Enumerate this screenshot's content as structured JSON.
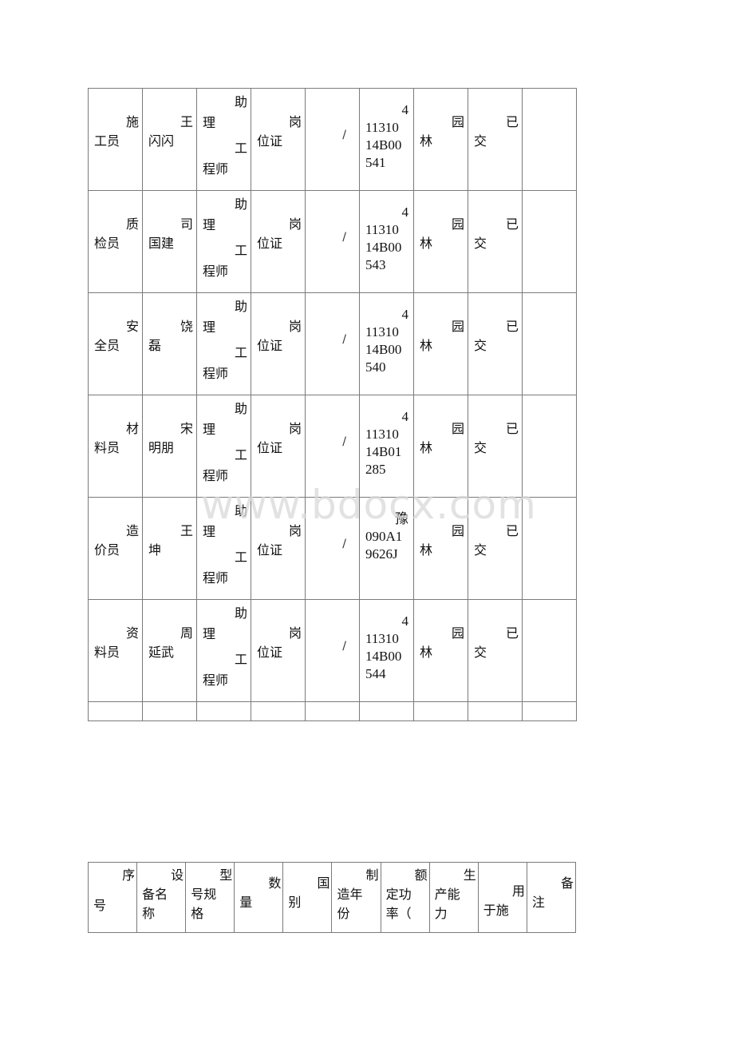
{
  "staff_table": {
    "rows": [
      {
        "role": [
          "施",
          "工员"
        ],
        "name": [
          "王",
          "闪闪"
        ],
        "title": [
          "助",
          "理",
          "工",
          "程师"
        ],
        "cert_type": [
          "岗",
          "位证"
        ],
        "cert_level": "/",
        "cert_no": [
          "4",
          "11310",
          "14B00",
          "541"
        ],
        "major": [
          "园",
          "林"
        ],
        "status": [
          "已",
          "交"
        ],
        "remark": ""
      },
      {
        "role": [
          "质",
          "检员"
        ],
        "name": [
          "司",
          "国建"
        ],
        "title": [
          "助",
          "理",
          "工",
          "程师"
        ],
        "cert_type": [
          "岗",
          "位证"
        ],
        "cert_level": "/",
        "cert_no": [
          "4",
          "11310",
          "14B00",
          "543"
        ],
        "major": [
          "园",
          "林"
        ],
        "status": [
          "已",
          "交"
        ],
        "remark": ""
      },
      {
        "role": [
          "安",
          "全员"
        ],
        "name": [
          "饶",
          "磊"
        ],
        "title": [
          "助",
          "理",
          "工",
          "程师"
        ],
        "cert_type": [
          "岗",
          "位证"
        ],
        "cert_level": "/",
        "cert_no": [
          "4",
          "11310",
          "14B00",
          "540"
        ],
        "major": [
          "园",
          "林"
        ],
        "status": [
          "已",
          "交"
        ],
        "remark": ""
      },
      {
        "role": [
          "材",
          "料员"
        ],
        "name": [
          "宋",
          "明朋"
        ],
        "title": [
          "助",
          "理",
          "工",
          "程师"
        ],
        "cert_type": [
          "岗",
          "位证"
        ],
        "cert_level": "/",
        "cert_no": [
          "4",
          "11310",
          "14B01",
          "285"
        ],
        "major": [
          "园",
          "林"
        ],
        "status": [
          "已",
          "交"
        ],
        "remark": ""
      },
      {
        "role": [
          "造",
          "价员"
        ],
        "name": [
          "王",
          "坤"
        ],
        "title": [
          "助",
          "理",
          "工",
          "程师"
        ],
        "cert_type": [
          "岗",
          "位证"
        ],
        "cert_level": "/",
        "cert_no": [
          "豫",
          "090A1",
          "9626J"
        ],
        "major": [
          "园",
          "林"
        ],
        "status": [
          "已",
          "交"
        ],
        "remark": ""
      },
      {
        "role": [
          "资",
          "料员"
        ],
        "name": [
          "周",
          "延武"
        ],
        "title": [
          "助",
          "理",
          "工",
          "程师"
        ],
        "cert_type": [
          "岗",
          "位证"
        ],
        "cert_level": "/",
        "cert_no": [
          "4",
          "11310",
          "14B00",
          "544"
        ],
        "major": [
          "园",
          "林"
        ],
        "status": [
          "已",
          "交"
        ],
        "remark": ""
      }
    ]
  },
  "equipment_table": {
    "headers": [
      [
        "序",
        "号"
      ],
      [
        "设",
        "备名",
        "称"
      ],
      [
        "型",
        "号规",
        "格"
      ],
      [
        "数",
        "量"
      ],
      [
        "国",
        "别"
      ],
      [
        "制",
        "造年",
        "份"
      ],
      [
        "额",
        "定功",
        "率（"
      ],
      [
        "生",
        "产能",
        "力"
      ],
      [
        "用",
        "于施"
      ],
      [
        "备",
        "注"
      ]
    ]
  },
  "watermark": "www.bdocx.com"
}
